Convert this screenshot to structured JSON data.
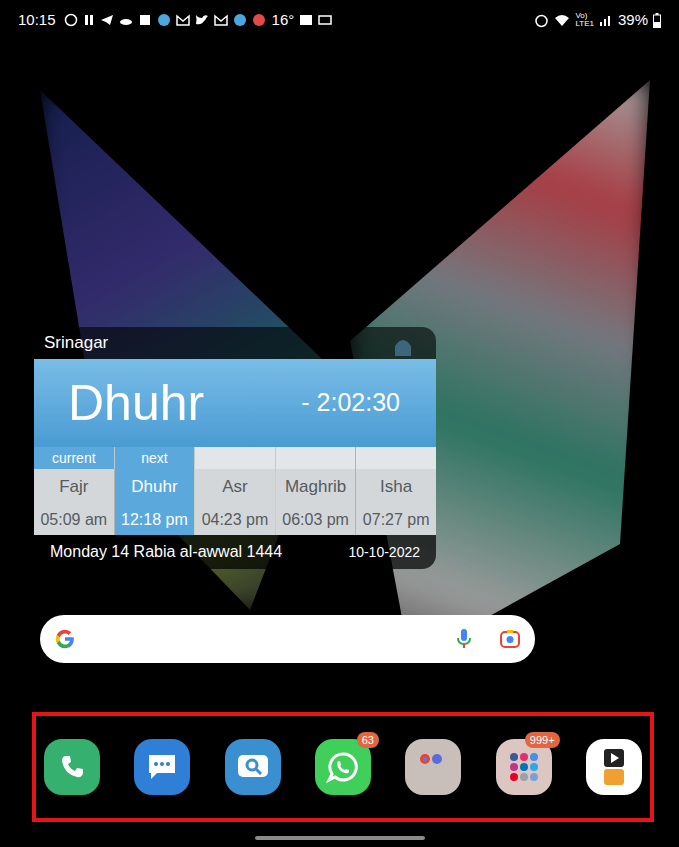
{
  "status_bar": {
    "time": "10:15",
    "temperature": "16°",
    "network_top": "Vo)",
    "network_bottom": "LTE1",
    "battery": "39%"
  },
  "prayer_widget": {
    "city": "Srinagar",
    "next_prayer": "Dhuhr",
    "countdown": "- 2:02:30",
    "prayers": [
      {
        "name": "Fajr",
        "time": "05:09 am",
        "tag": "current",
        "selected": false
      },
      {
        "name": "Dhuhr",
        "time": "12:18 pm",
        "tag": "next",
        "selected": true
      },
      {
        "name": "Asr",
        "time": "04:23 pm",
        "selected": false
      },
      {
        "name": "Maghrib",
        "time": "06:03 pm",
        "selected": false
      },
      {
        "name": "Isha",
        "time": "07:27 pm",
        "selected": false
      }
    ],
    "hijri_date": "Monday 14 Rabia al-awwal 1444",
    "date": "10-10-2022"
  },
  "dock": {
    "highlighted": true,
    "apps": [
      {
        "kind": "phone",
        "badge": ""
      },
      {
        "kind": "messages",
        "badge": ""
      },
      {
        "kind": "finder",
        "badge": ""
      },
      {
        "kind": "whatsapp",
        "badge": "63"
      },
      {
        "kind": "folder-google",
        "badge": ""
      },
      {
        "kind": "folder-social",
        "badge": "999+"
      },
      {
        "kind": "video",
        "badge": ""
      }
    ]
  }
}
